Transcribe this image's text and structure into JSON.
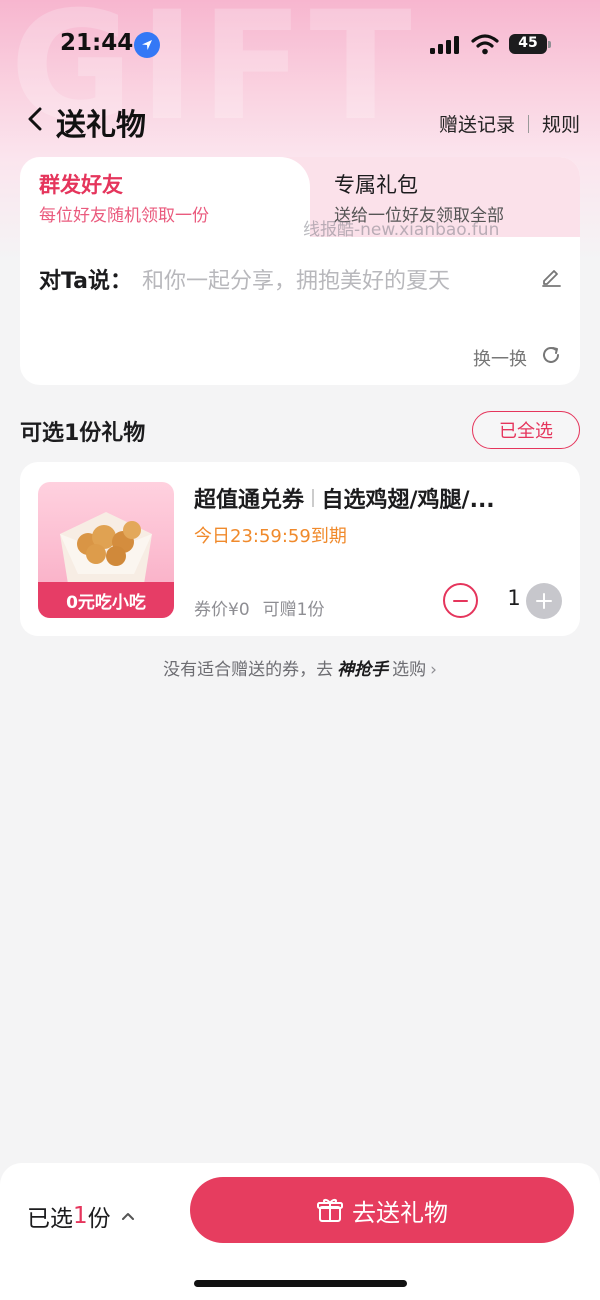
{
  "status_bar": {
    "time": "21:44",
    "battery": "45"
  },
  "header": {
    "title": "送礼物",
    "record_link": "赠送记录",
    "rules_link": "规则"
  },
  "tabs": [
    {
      "title": "群发好友",
      "subtitle": "每位好友随机领取一份"
    },
    {
      "title": "专属礼包",
      "subtitle": "送给一位好友领取全部"
    }
  ],
  "watermark": "线报酷-new.xianbao.fun",
  "message": {
    "label": "对Ta说：",
    "text": "和你一起分享，拥抱美好的夏天",
    "swap_label": "换一换"
  },
  "section": {
    "title": "可选1份礼物",
    "select_all_label": "已全选"
  },
  "product": {
    "name_prefix": "超值通兑券",
    "name_suffix": "自选鸡翅/鸡腿/...",
    "expiry": "今日23:59:59到期",
    "badge": "0元吃小吃",
    "price": "券价¥0",
    "giftable": "可赠1份",
    "quantity": "1"
  },
  "hint": {
    "text_before": "没有适合赠送的券，去",
    "brand": "神抢手",
    "text_after": "选购"
  },
  "bottom": {
    "selected_prefix": "已选",
    "selected_count": "1",
    "selected_suffix": "份",
    "send_label": "去送礼物"
  },
  "colors": {
    "accent": "#e5355c",
    "expiry": "#f08a2c",
    "tab_bg": "#fbe1ea"
  }
}
